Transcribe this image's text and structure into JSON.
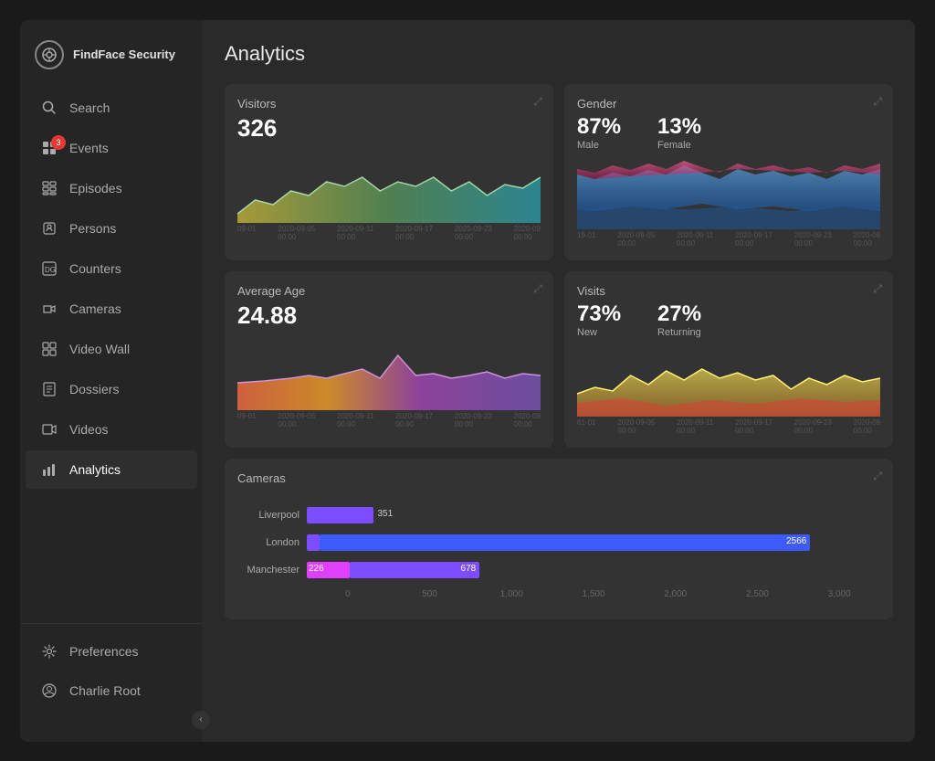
{
  "app": {
    "title": "FindFace Security"
  },
  "sidebar": {
    "logo_label": "FindFace Security",
    "items": [
      {
        "id": "search",
        "label": "Search",
        "icon": "🔍"
      },
      {
        "id": "events",
        "label": "Events",
        "icon": "⊞",
        "badge": "3"
      },
      {
        "id": "episodes",
        "label": "Episodes",
        "icon": "▦"
      },
      {
        "id": "persons",
        "label": "Persons",
        "icon": "🎭"
      },
      {
        "id": "counters",
        "label": "Counters",
        "icon": "⊡"
      },
      {
        "id": "cameras",
        "label": "Cameras",
        "icon": "📷"
      },
      {
        "id": "videowall",
        "label": "Video Wall",
        "icon": "⊞"
      },
      {
        "id": "dossiers",
        "label": "Dossiers",
        "icon": "📋"
      },
      {
        "id": "videos",
        "label": "Videos",
        "icon": "🎬"
      },
      {
        "id": "analytics",
        "label": "Analytics",
        "icon": "📊",
        "active": true
      }
    ],
    "bottom_items": [
      {
        "id": "preferences",
        "label": "Preferences",
        "icon": "⚙"
      },
      {
        "id": "user",
        "label": "Charlie Root",
        "icon": "👤"
      }
    ]
  },
  "page": {
    "title": "Analytics"
  },
  "charts": {
    "visitors": {
      "title": "Visitors",
      "value": "326"
    },
    "gender": {
      "title": "Gender",
      "male_pct": "87%",
      "male_label": "Male",
      "female_pct": "13%",
      "female_label": "Female"
    },
    "average_age": {
      "title": "Average Age",
      "value": "24.88"
    },
    "visits": {
      "title": "Visits",
      "new_pct": "73%",
      "new_label": "New",
      "returning_pct": "27%",
      "returning_label": "Returning"
    },
    "cameras": {
      "title": "Cameras",
      "rows": [
        {
          "label": "Liverpool",
          "val1": 351,
          "val2": null,
          "color1": "#7c4dff"
        },
        {
          "label": "London",
          "val1": 68,
          "val2": 2566,
          "color1": "#7c4dff",
          "color2": "#3d5afe"
        },
        {
          "label": "Manchester",
          "val1": 226,
          "val2": 678,
          "color1": "#e040fb",
          "color2": "#7c4dff"
        }
      ],
      "axis_labels": [
        "0",
        "500",
        "1,000",
        "1,500",
        "2,000",
        "2,500",
        "3,000"
      ],
      "max_value": 3000
    }
  },
  "timeline": {
    "labels": [
      "09-01",
      "2020-09-05\n00:00",
      "2020-09-11\n00:00",
      "2020-09-17\n00:00",
      "2020-09-23\n00:00",
      "2020-09\n00:00"
    ]
  }
}
